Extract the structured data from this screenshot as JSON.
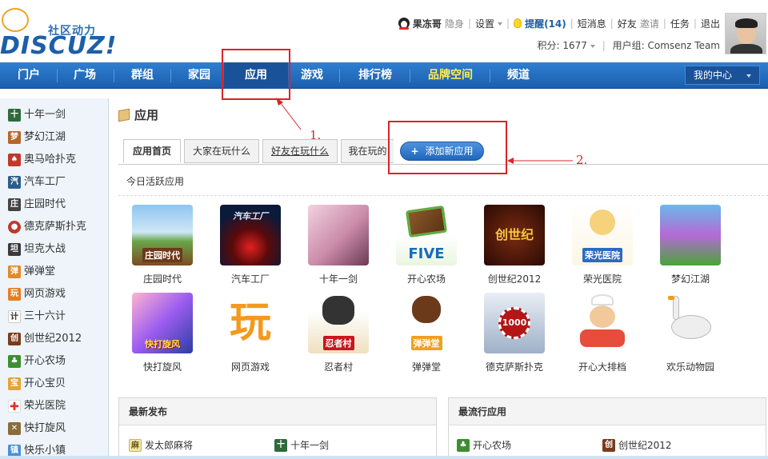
{
  "logo": {
    "tagline": "社区动力",
    "wordmark": "DISCUZ!"
  },
  "userbar": {
    "username": "果冻哥",
    "status": "隐身",
    "settings": "设置",
    "remind": "提醒(14)",
    "messages": "短消息",
    "friends": "好友",
    "invite": "邀请",
    "tasks": "任务",
    "logout": "退出"
  },
  "scorebar": {
    "points": "积分: 1677",
    "usergroup": "用户组: Comsenz Team"
  },
  "nav": {
    "items": [
      "门户",
      "广场",
      "群组",
      "家园",
      "应用",
      "游戏",
      "排行榜",
      "品牌空间",
      "频道"
    ],
    "my_center": "我的中心"
  },
  "sidebar": {
    "items": [
      {
        "label": "十年一剑",
        "icon": "sword-icon"
      },
      {
        "label": "梦幻江湖",
        "icon": "fantasy-icon"
      },
      {
        "label": "奥马哈扑克",
        "icon": "poker-icon"
      },
      {
        "label": "汽车工厂",
        "icon": "car-factory-icon"
      },
      {
        "label": "庄园时代",
        "icon": "manor-icon"
      },
      {
        "label": "德克萨斯扑克",
        "icon": "texas-poker-icon"
      },
      {
        "label": "坦克大战",
        "icon": "tank-icon"
      },
      {
        "label": "弹弹堂",
        "icon": "ddt-icon"
      },
      {
        "label": "网页游戏",
        "icon": "web-game-icon"
      },
      {
        "label": "三十六计",
        "icon": "strategy-icon"
      },
      {
        "label": "创世纪2012",
        "icon": "genesis-icon"
      },
      {
        "label": "开心农场",
        "icon": "farm-icon"
      },
      {
        "label": "开心宝贝",
        "icon": "baby-icon"
      },
      {
        "label": "荣光医院",
        "icon": "hospital-icon"
      },
      {
        "label": "快打旋风",
        "icon": "fighter-icon"
      },
      {
        "label": "快乐小镇",
        "icon": "town-icon"
      }
    ]
  },
  "main": {
    "title": "应用",
    "tabs": [
      "应用首页",
      "大家在玩什么",
      "好友在玩什么",
      "我在玩的"
    ],
    "add_app": "添加新应用",
    "today_label": "今日活跃应用",
    "apps_row1": [
      "庄园时代",
      "汽车工厂",
      "十年一剑",
      "开心农场",
      "创世纪2012",
      "荣光医院",
      "梦幻江湖"
    ],
    "apps_row2": [
      "快打旋风",
      "网页游戏",
      "忍者村",
      "弹弹堂",
      "德克萨斯扑克",
      "开心大排档",
      "欢乐动物园"
    ],
    "app_icon_text": {
      "manor": "庄园时代",
      "car": "汽车工厂",
      "farm": "FIVE",
      "genesis": "创世纪",
      "hospital": "荣光医院",
      "fighter": "快打旋风",
      "webgame": "玩",
      "ninja": "忍者村",
      "ddt": "弹弹堂",
      "poker": "1000"
    },
    "panels": {
      "latest": {
        "title": "最新发布",
        "items": [
          "发太郎麻将",
          "十年一剑"
        ]
      },
      "popular": {
        "title": "最流行应用",
        "items": [
          "开心农场",
          "创世纪2012"
        ]
      }
    }
  },
  "annotations": {
    "label1": "1.",
    "label2": "2.",
    "color": "#d8242a"
  },
  "colors": {
    "nav": "#1b5fae",
    "accent": "#2b6fb6",
    "brand_nav": "#ffee55"
  }
}
